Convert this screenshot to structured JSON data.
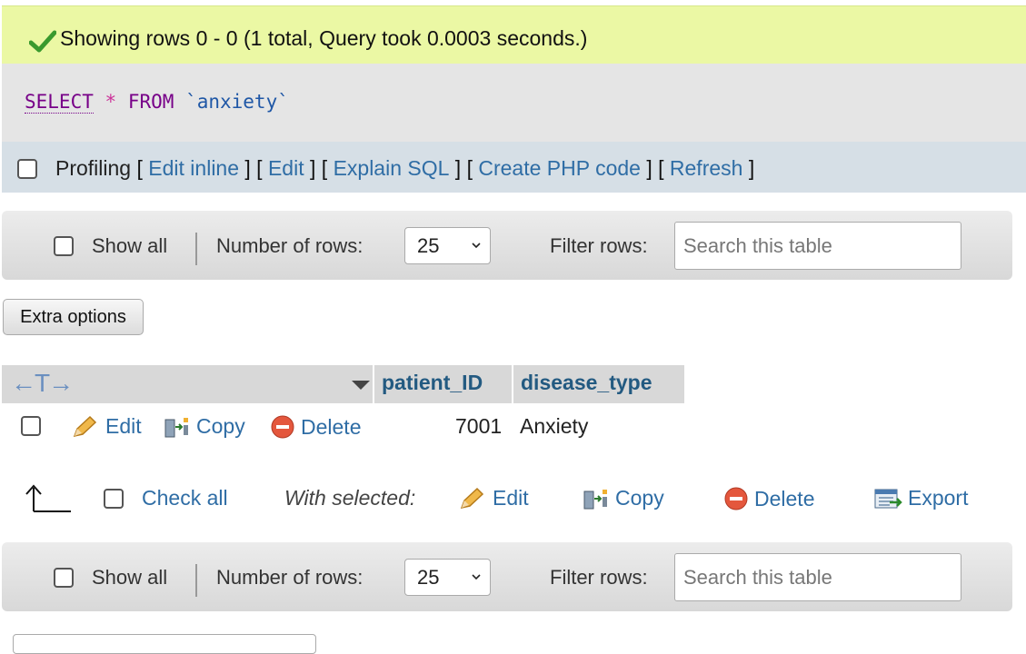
{
  "success": {
    "message": "Showing rows 0 - 0 (1 total, Query took 0.0003 seconds.)",
    "icon": "checkmark-icon",
    "color": "#ebf8a4"
  },
  "sql": {
    "select": "SELECT",
    "star": "*",
    "from": "FROM",
    "table": "`anxiety`"
  },
  "profiling": {
    "label": "Profiling",
    "links": [
      "Edit inline",
      "Edit",
      "Explain SQL",
      "Create PHP code",
      "Refresh"
    ]
  },
  "nav": {
    "show_all": "Show all",
    "number_of_rows_label": "Number of rows:",
    "rows_value": "25",
    "filter_label": "Filter rows:",
    "search_placeholder": "Search this table"
  },
  "extra_options": "Extra options",
  "table": {
    "columns": [
      "patient_ID",
      "disease_type"
    ],
    "rows": [
      {
        "patient_ID": "7001",
        "disease_type": "Anxiety"
      }
    ],
    "row_actions": {
      "edit": "Edit",
      "copy": "Copy",
      "delete": "Delete"
    }
  },
  "with_selected": {
    "check_all": "Check all",
    "label": "With selected:",
    "edit": "Edit",
    "copy": "Copy",
    "delete": "Delete",
    "export": "Export"
  },
  "colors": {
    "link": "#2f6da5",
    "header_text": "#235a81",
    "sql_keyword": "#770088",
    "sql_table": "#1f57a6"
  }
}
